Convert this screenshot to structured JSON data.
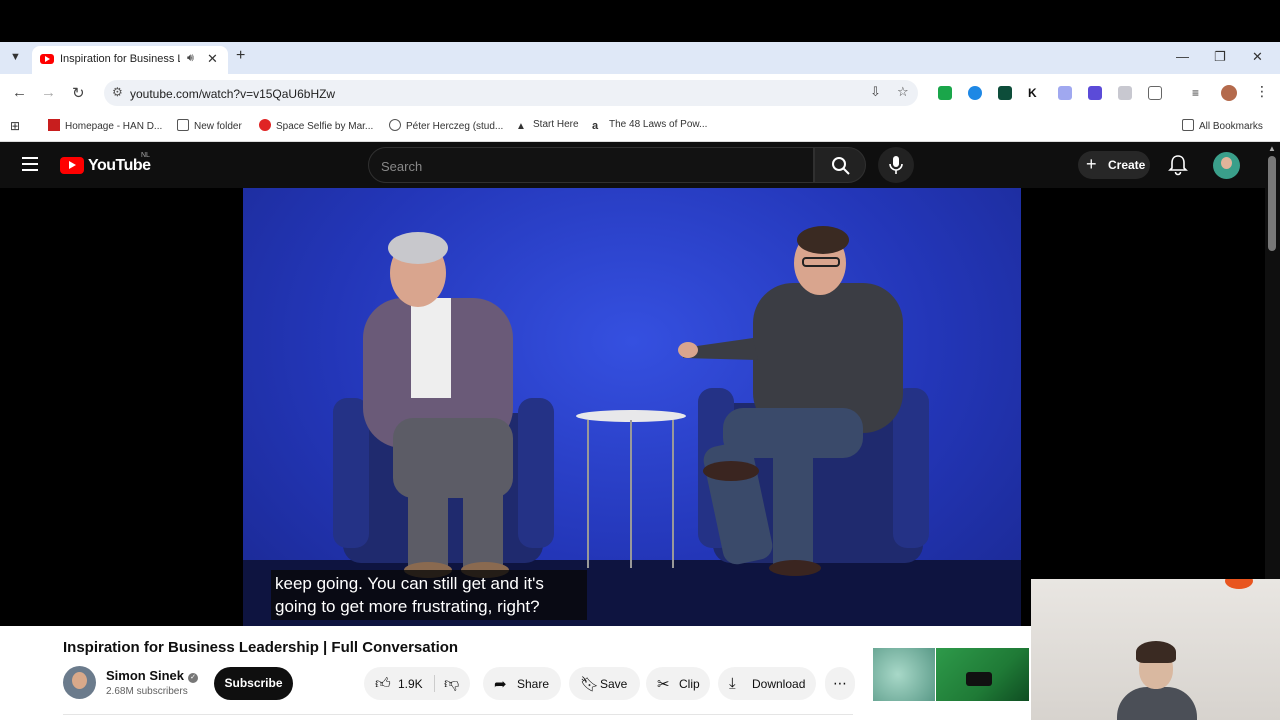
{
  "browser": {
    "tab_title": "Inspiration for Business Lea",
    "url": "youtube.com/watch?v=v15QaU6bHZw",
    "bookmarks": [
      {
        "label": "Homepage - HAN D...",
        "icon": "han-icon"
      },
      {
        "label": "New folder",
        "icon": "folder-icon"
      },
      {
        "label": "Space Selfie by Mar...",
        "icon": "selfie-icon"
      },
      {
        "label": "Péter Herczeg (stud...",
        "icon": "globe-icon"
      },
      {
        "label": "Start Here",
        "icon": "triangle-icon"
      },
      {
        "label": "The 48 Laws of Pow...",
        "icon": "amazon-icon"
      }
    ],
    "all_bookmarks": "All Bookmarks"
  },
  "youtube": {
    "logo_text": "YouTube",
    "region": "NL",
    "search_placeholder": "Search",
    "create_label": "Create"
  },
  "video": {
    "caption_line1": "keep going. You can still get and it's",
    "caption_line2": "going to get more frustrating, right?",
    "title": "Inspiration for Business Leadership | Full Conversation",
    "channel": "Simon Sinek",
    "subscribers": "2.68M subscribers",
    "subscribe_label": "Subscribe",
    "likes": "1.9K",
    "share_label": "Share",
    "save_label": "Save",
    "clip_label": "Clip",
    "download_label": "Download"
  },
  "colors": {
    "youtube_red": "#ff0000",
    "yt_dark": "#0f0f0f",
    "stage_blue": "#2336b8"
  }
}
